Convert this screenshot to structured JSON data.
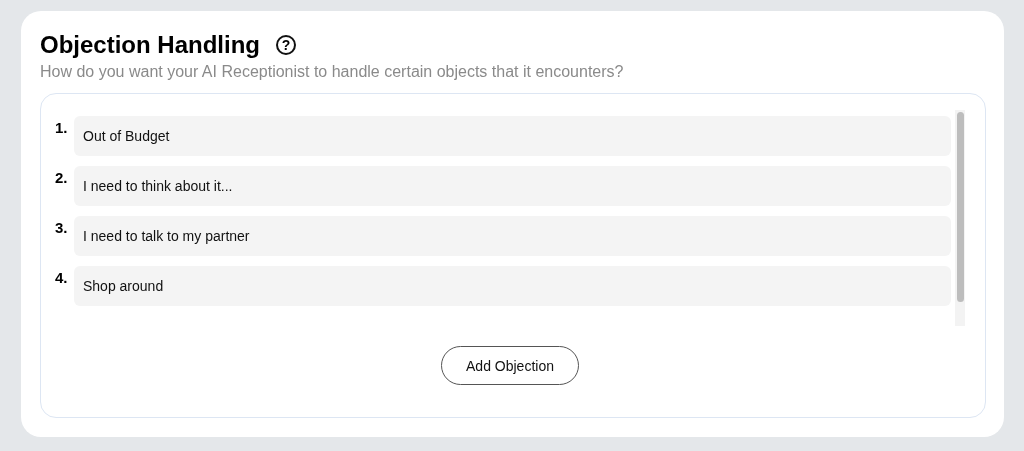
{
  "header": {
    "title": "Objection Handling",
    "help_icon": "?",
    "subtitle": "How do you want your AI Receptionist to handle certain objects that it encounters?"
  },
  "objections": [
    {
      "number": "1.",
      "value": "Out of Budget"
    },
    {
      "number": "2.",
      "value": "I need to think about it..."
    },
    {
      "number": "3.",
      "value": "I need to talk to my partner"
    },
    {
      "number": "4.",
      "value": "Shop around"
    }
  ],
  "add_button": "Add Objection"
}
